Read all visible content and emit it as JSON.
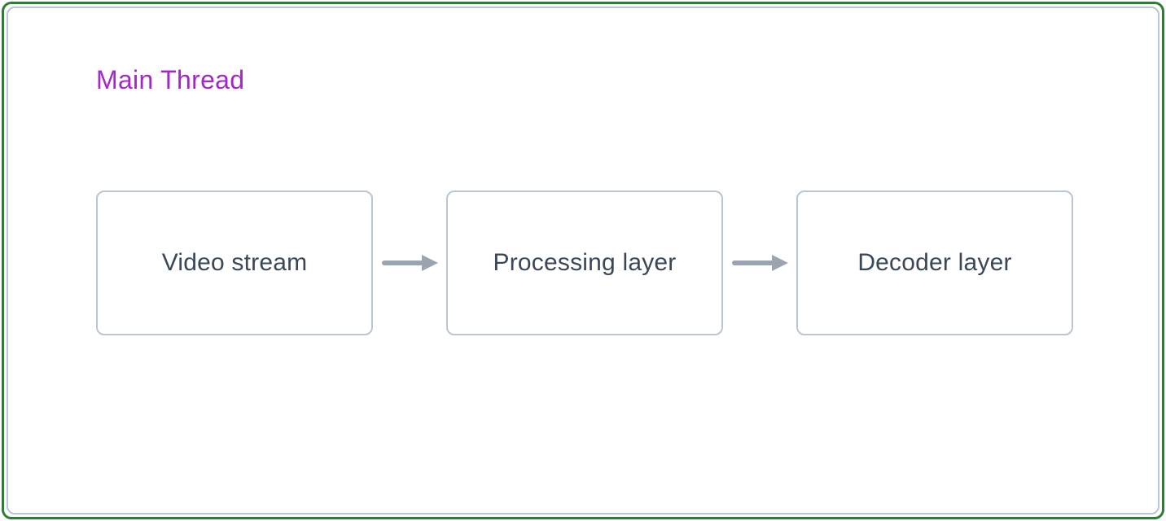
{
  "title": "Main Thread",
  "nodes": {
    "0": {
      "label": "Video stream"
    },
    "1": {
      "label": "Processing layer"
    },
    "2": {
      "label": "Decoder layer"
    }
  },
  "colors": {
    "title": "#a428c9",
    "node_border": "#b9c7d3",
    "node_text": "#3a4756",
    "arrow": "#9aa5b1",
    "outer_border": "#2e7d32"
  }
}
